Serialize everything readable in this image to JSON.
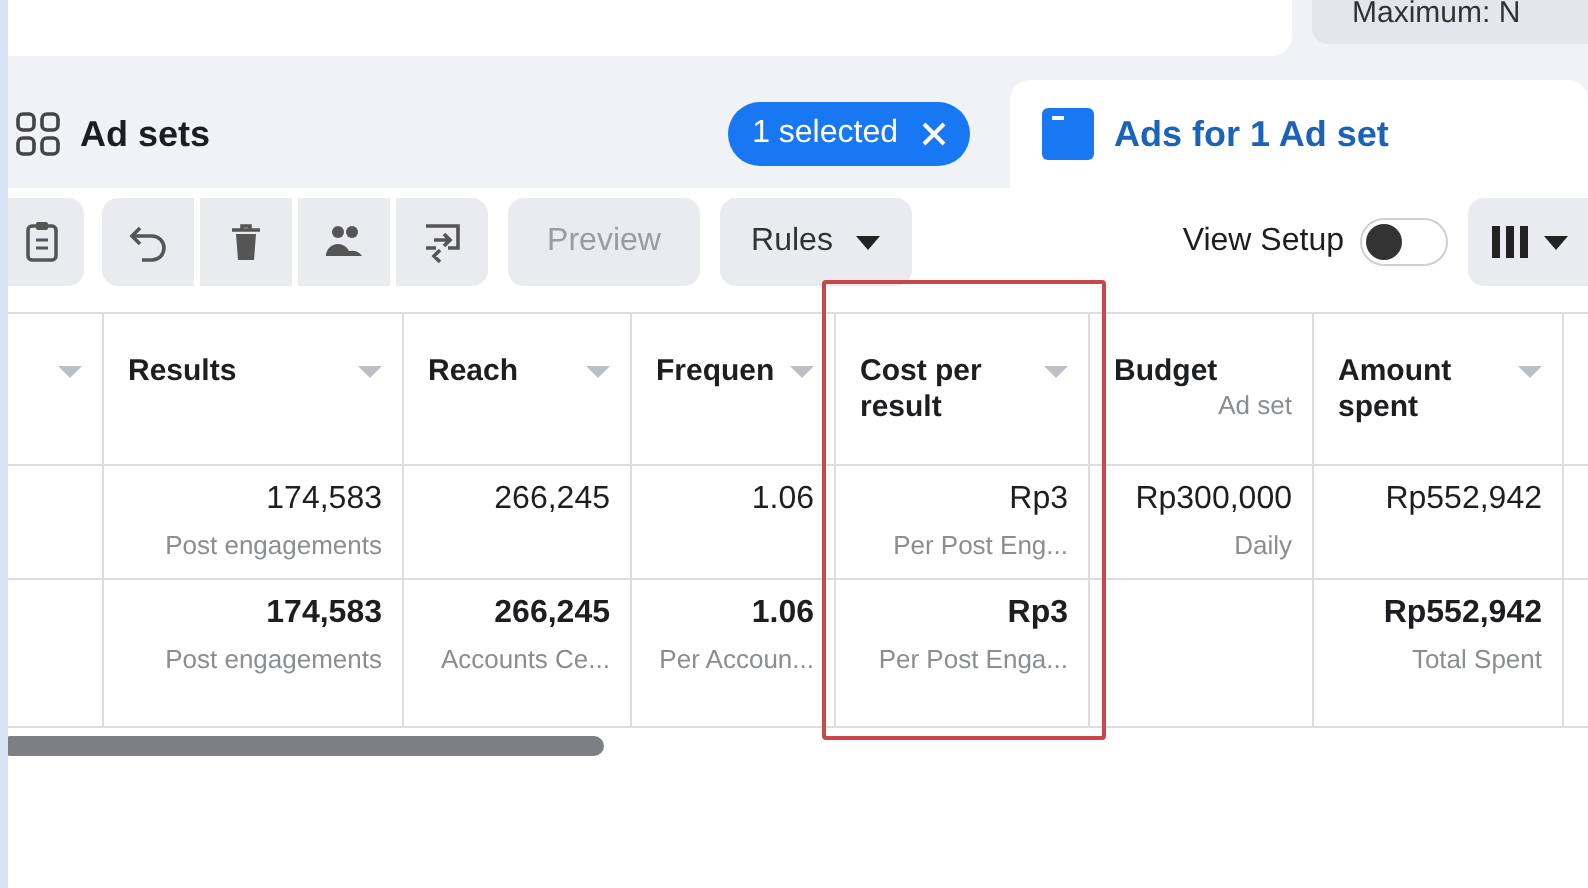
{
  "top_field": {
    "value": "Maximum: N"
  },
  "panes": [
    {
      "kind": "adsets",
      "label": "Ad sets",
      "selected": false,
      "badge": "1 selected"
    },
    {
      "kind": "ads",
      "label": "Ads for 1 Ad set",
      "selected": true
    }
  ],
  "toolbar": [
    {
      "kind": "icon"
    },
    {
      "kind": "icon"
    },
    {
      "kind": "icon"
    },
    {
      "kind": "icon"
    },
    {
      "kind": "icon"
    },
    {
      "kind": "text",
      "label": "Preview",
      "disabled": true
    },
    {
      "kind": "dropdown",
      "label": "Rules",
      "disabled": false
    }
  ],
  "view_setup": {
    "label": "View Setup",
    "on": false
  },
  "table": {
    "columns": [
      {
        "sortable": true
      },
      {
        "label": "Results",
        "sortable": true
      },
      {
        "label": "Reach",
        "sortable": true
      },
      {
        "label": "Frequen",
        "sortable": true
      },
      {
        "label": "Cost per result",
        "sortable": true,
        "highlighted": true
      },
      {
        "label": "Budget",
        "sub": "Ad set",
        "sortable": false
      },
      {
        "label": "Amount spent",
        "sortable": true
      },
      {
        "sortable": false
      }
    ],
    "rows": [
      {
        "kind": "item",
        "cells": [
          {},
          {
            "value": "174,583",
            "sub": "Post engagements"
          },
          {
            "value": "266,245"
          },
          {
            "value": "1.06"
          },
          {
            "value": "Rp3",
            "sub": "Per Post Eng..."
          },
          {
            "value": "Rp300,000",
            "sub": "Daily"
          },
          {
            "value": "Rp552,942"
          },
          {}
        ]
      },
      {
        "kind": "total",
        "cells": [
          {},
          {
            "value": "174,583",
            "sub": "Post engagements"
          },
          {
            "value": "266,245",
            "sub": "Accounts Ce..."
          },
          {
            "value": "1.06",
            "sub": "Per Accoun..."
          },
          {
            "value": "Rp3",
            "sub": "Per Post Enga..."
          },
          {},
          {
            "value": "Rp552,942",
            "sub": "Total Spent"
          },
          {}
        ]
      }
    ]
  }
}
